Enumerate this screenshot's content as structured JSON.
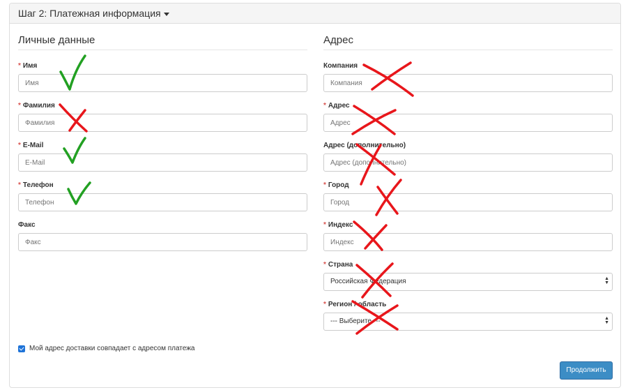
{
  "panel": {
    "title": "Шаг 2: Платежная информация"
  },
  "personal": {
    "legend": "Личные данные",
    "fields": [
      {
        "label": "Имя",
        "required": true,
        "placeholder": "Имя"
      },
      {
        "label": "Фамилия",
        "required": true,
        "placeholder": "Фамилия"
      },
      {
        "label": "E-Mail",
        "required": true,
        "placeholder": "E-Mail"
      },
      {
        "label": "Телефон",
        "required": true,
        "placeholder": "Телефон"
      },
      {
        "label": "Факс",
        "required": false,
        "placeholder": "Факс"
      }
    ]
  },
  "address": {
    "legend": "Адрес",
    "fields": [
      {
        "label": "Компания",
        "required": false,
        "placeholder": "Компания"
      },
      {
        "label": "Адрес",
        "required": true,
        "placeholder": "Адрес"
      },
      {
        "label": "Адрес (дополнительно)",
        "required": false,
        "placeholder": "Адрес (дополнительно)"
      },
      {
        "label": "Город",
        "required": true,
        "placeholder": "Город"
      },
      {
        "label": "Индекс",
        "required": true,
        "placeholder": "Индекс"
      },
      {
        "label": "Страна",
        "required": true,
        "value": "Российская Федерация"
      },
      {
        "label": "Регион / область",
        "required": true,
        "value": "--- Выберите ---"
      }
    ]
  },
  "shipping_checkbox": {
    "label": "Мой адрес доставки совпадает с адресом платежа",
    "checked": true
  },
  "continue_button": {
    "label": "Продолжить"
  },
  "annotations": {
    "check_color": "#22a022",
    "cross_color": "#e8161b",
    "checks": [
      "Имя",
      "E-Mail",
      "Телефон"
    ],
    "crosses": [
      "Фамилия",
      "Компания",
      "Адрес",
      "Адрес (дополнительно)",
      "Город",
      "Индекс",
      "Страна",
      "Регион / область"
    ]
  },
  "colors": {
    "required_star": "#d9534f",
    "button_bg": "#3c8dc5",
    "checkbox": "#1e73d8"
  }
}
